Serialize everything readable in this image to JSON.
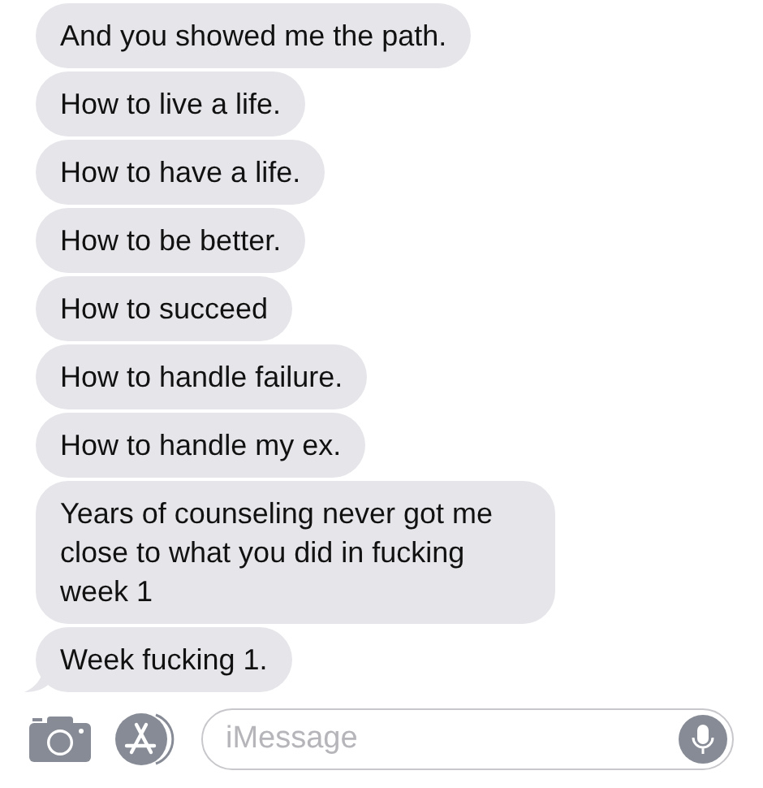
{
  "messages": [
    {
      "text": "And you showed me the path.",
      "tail": false
    },
    {
      "text": "How to live a life.",
      "tail": false
    },
    {
      "text": "How to have a life.",
      "tail": false
    },
    {
      "text": "How to be better.",
      "tail": false
    },
    {
      "text": "How to succeed",
      "tail": false
    },
    {
      "text": "How to handle failure.",
      "tail": false
    },
    {
      "text": "How to handle my ex.",
      "tail": false
    },
    {
      "text": "Years of counseling never got me close to what you did in fucking week 1",
      "tail": false
    },
    {
      "text": "Week fucking 1.",
      "tail": true
    }
  ],
  "composer": {
    "placeholder": "iMessage"
  }
}
